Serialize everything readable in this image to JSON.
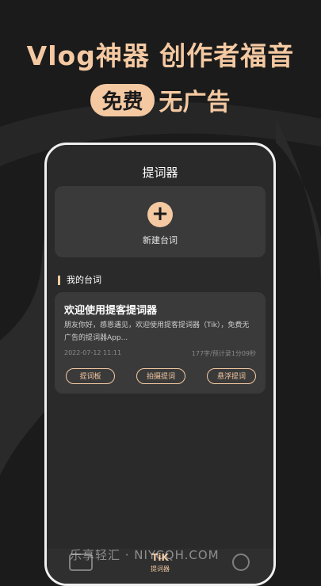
{
  "promo": {
    "headline": "Vlog神器 创作者福音",
    "badge": "免费",
    "tagline": "无广告",
    "accent_color": "#f4c9a2"
  },
  "app": {
    "title": "提词器",
    "new_script": {
      "icon": "plus-icon",
      "label": "新建台词"
    },
    "section_title": "我的台词",
    "script_card": {
      "title": "欢迎使用提客提词器",
      "body": "朋友你好，感恩遇见，欢迎使用提客提词器（Tik），免费无广告的提词器App...",
      "date": "2022-07-12 11:11",
      "meta": "177字/预计录1分09秒",
      "actions": [
        "提词板",
        "拍摄提词",
        "悬浮提词"
      ]
    },
    "tabbar": {
      "left_icon": "scripts-icon",
      "center_icon_text": "TiK",
      "center_label": "提词器",
      "right_icon": "profile-icon"
    }
  },
  "watermark": "乐享轻汇 · NIYCQH.COM"
}
